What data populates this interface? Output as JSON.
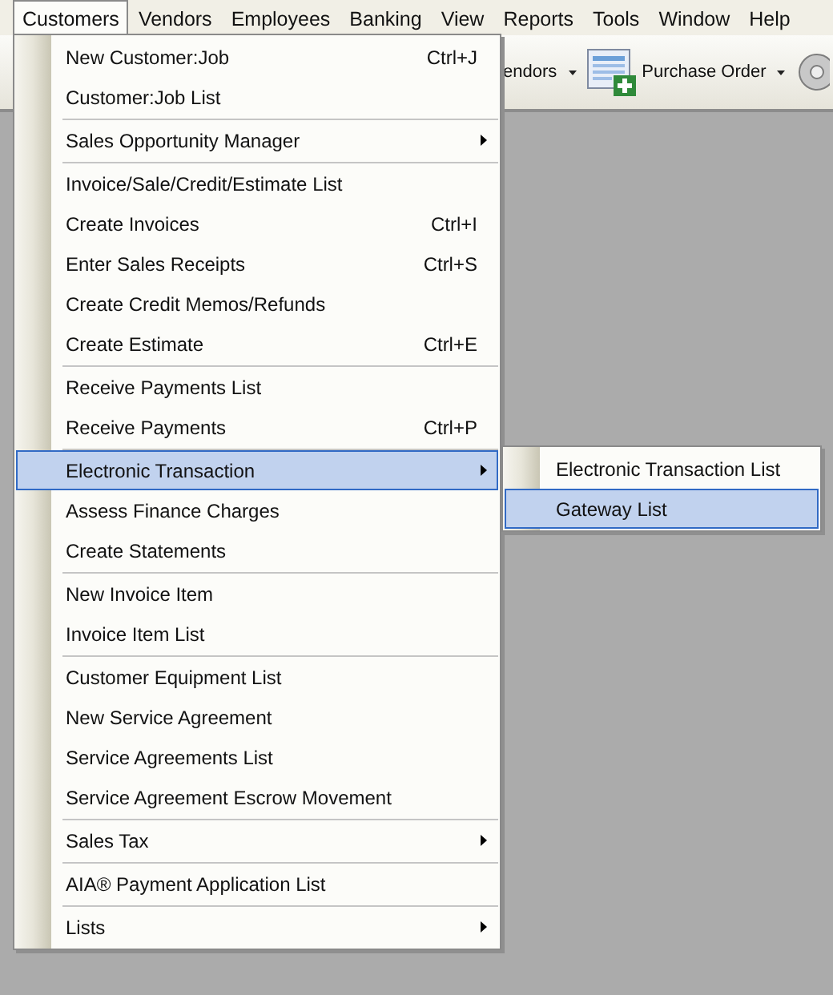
{
  "menubar": [
    {
      "label": "Customers",
      "selected": true
    },
    {
      "label": "Vendors",
      "selected": false
    },
    {
      "label": "Employees",
      "selected": false
    },
    {
      "label": "Banking",
      "selected": false
    },
    {
      "label": "View",
      "selected": false
    },
    {
      "label": "Reports",
      "selected": false
    },
    {
      "label": "Tools",
      "selected": false
    },
    {
      "label": "Window",
      "selected": false
    },
    {
      "label": "Help",
      "selected": false
    }
  ],
  "toolbar": [
    {
      "label": "endors",
      "kind": "text"
    },
    {
      "label": "Purchase Order",
      "kind": "icon-text"
    }
  ],
  "menu": {
    "items": [
      {
        "kind": "item",
        "label": "New Customer:Job",
        "shortcut": "Ctrl+J",
        "submenu": false,
        "selected": false
      },
      {
        "kind": "item",
        "label": "Customer:Job List",
        "submenu": false,
        "selected": false
      },
      {
        "kind": "separator"
      },
      {
        "kind": "item",
        "label": "Sales Opportunity Manager",
        "submenu": true,
        "selected": false
      },
      {
        "kind": "separator"
      },
      {
        "kind": "item",
        "label": "Invoice/Sale/Credit/Estimate List",
        "submenu": false,
        "selected": false
      },
      {
        "kind": "item",
        "label": "Create Invoices",
        "shortcut": "Ctrl+I",
        "submenu": false,
        "selected": false
      },
      {
        "kind": "item",
        "label": "Enter Sales Receipts",
        "shortcut": "Ctrl+S",
        "submenu": false,
        "selected": false
      },
      {
        "kind": "item",
        "label": "Create Credit Memos/Refunds",
        "submenu": false,
        "selected": false
      },
      {
        "kind": "item",
        "label": "Create Estimate",
        "shortcut": "Ctrl+E",
        "submenu": false,
        "selected": false
      },
      {
        "kind": "separator"
      },
      {
        "kind": "item",
        "label": "Receive Payments List",
        "submenu": false,
        "selected": false
      },
      {
        "kind": "item",
        "label": "Receive Payments",
        "shortcut": "Ctrl+P",
        "submenu": false,
        "selected": false
      },
      {
        "kind": "separator"
      },
      {
        "kind": "item",
        "label": "Electronic Transaction",
        "submenu": true,
        "selected": true
      },
      {
        "kind": "item",
        "label": "Assess Finance Charges",
        "submenu": false,
        "selected": false
      },
      {
        "kind": "item",
        "label": "Create Statements",
        "submenu": false,
        "selected": false
      },
      {
        "kind": "separator"
      },
      {
        "kind": "item",
        "label": "New Invoice Item",
        "submenu": false,
        "selected": false
      },
      {
        "kind": "item",
        "label": "Invoice Item List",
        "submenu": false,
        "selected": false
      },
      {
        "kind": "separator"
      },
      {
        "kind": "item",
        "label": "Customer Equipment List",
        "submenu": false,
        "selected": false
      },
      {
        "kind": "item",
        "label": "New Service Agreement",
        "submenu": false,
        "selected": false
      },
      {
        "kind": "item",
        "label": "Service Agreements List",
        "submenu": false,
        "selected": false
      },
      {
        "kind": "item",
        "label": "Service Agreement Escrow Movement",
        "submenu": false,
        "selected": false
      },
      {
        "kind": "separator"
      },
      {
        "kind": "item",
        "label": "Sales Tax",
        "submenu": true,
        "selected": false
      },
      {
        "kind": "separator"
      },
      {
        "kind": "item",
        "label": "AIA® Payment Application List",
        "submenu": false,
        "selected": false
      },
      {
        "kind": "separator"
      },
      {
        "kind": "item",
        "label": "Lists",
        "submenu": true,
        "selected": false
      }
    ]
  },
  "submenu": {
    "items": [
      {
        "label": "Electronic Transaction List",
        "selected": false
      },
      {
        "label": "Gateway List",
        "selected": true
      }
    ]
  }
}
